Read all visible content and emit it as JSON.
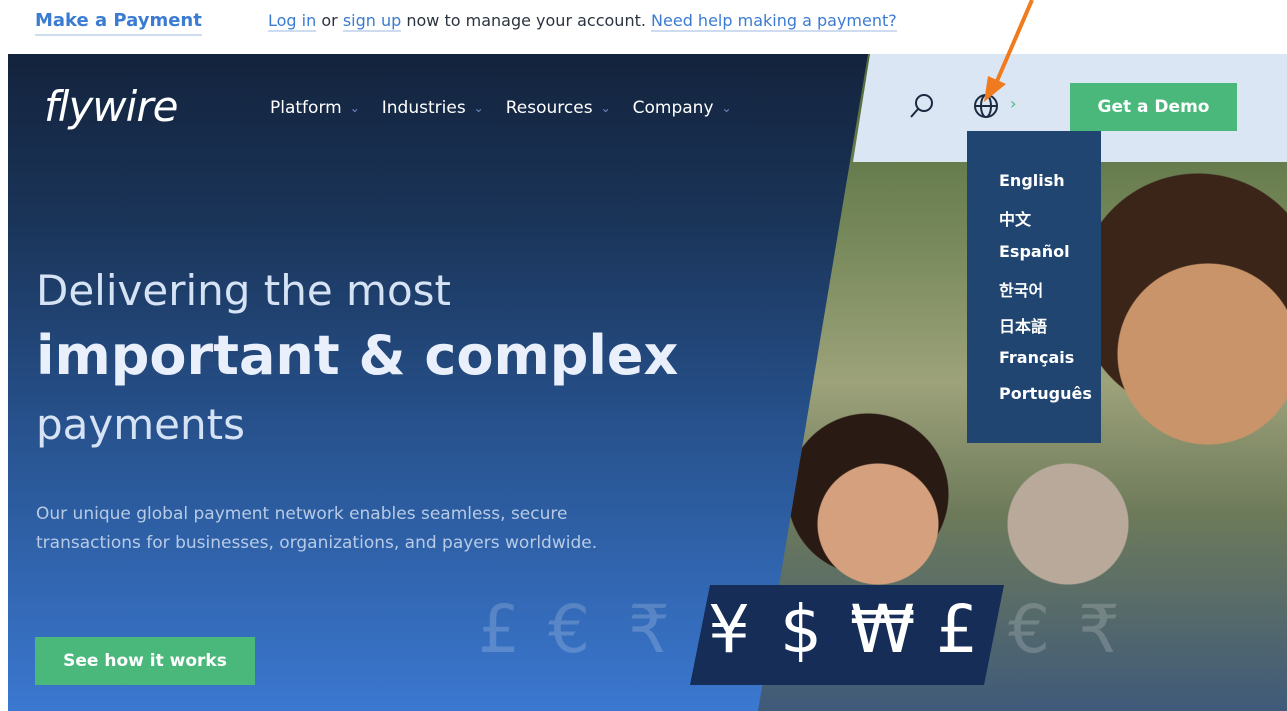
{
  "topbar": {
    "make_payment": "Make a Payment",
    "login": "Log in",
    "or": "or",
    "signup": "sign up",
    "now_text": "now to manage your account.",
    "help": "Need help making a payment?"
  },
  "header": {
    "logo": "flywire",
    "nav": [
      {
        "label": "Platform"
      },
      {
        "label": "Industries"
      },
      {
        "label": "Resources"
      },
      {
        "label": "Company"
      }
    ],
    "demo_label": "Get a Demo"
  },
  "language_menu": {
    "items": [
      "English",
      "中文",
      "Español",
      "한국어",
      "日本語",
      "Français",
      "Português"
    ]
  },
  "hero": {
    "line1": "Delivering the most",
    "line2": "important & complex",
    "line3": "payments",
    "description": "Our unique global payment network enables seamless, secure transactions for businesses, organizations, and payers worldwide.",
    "cta_label": "See how it works",
    "currencies": [
      "£",
      "€",
      "₹",
      "¥",
      "$",
      "₩",
      "£",
      "€",
      "₹"
    ]
  },
  "colors": {
    "accent_green": "#4ab87b",
    "link_blue": "#3b7bd1",
    "menu_bg": "#1f4570",
    "arrow_orange": "#f07b1e"
  },
  "icons": [
    "search-icon",
    "globe-icon",
    "chevron-down-icon",
    "chevron-right-icon",
    "annotation-arrow-icon"
  ]
}
